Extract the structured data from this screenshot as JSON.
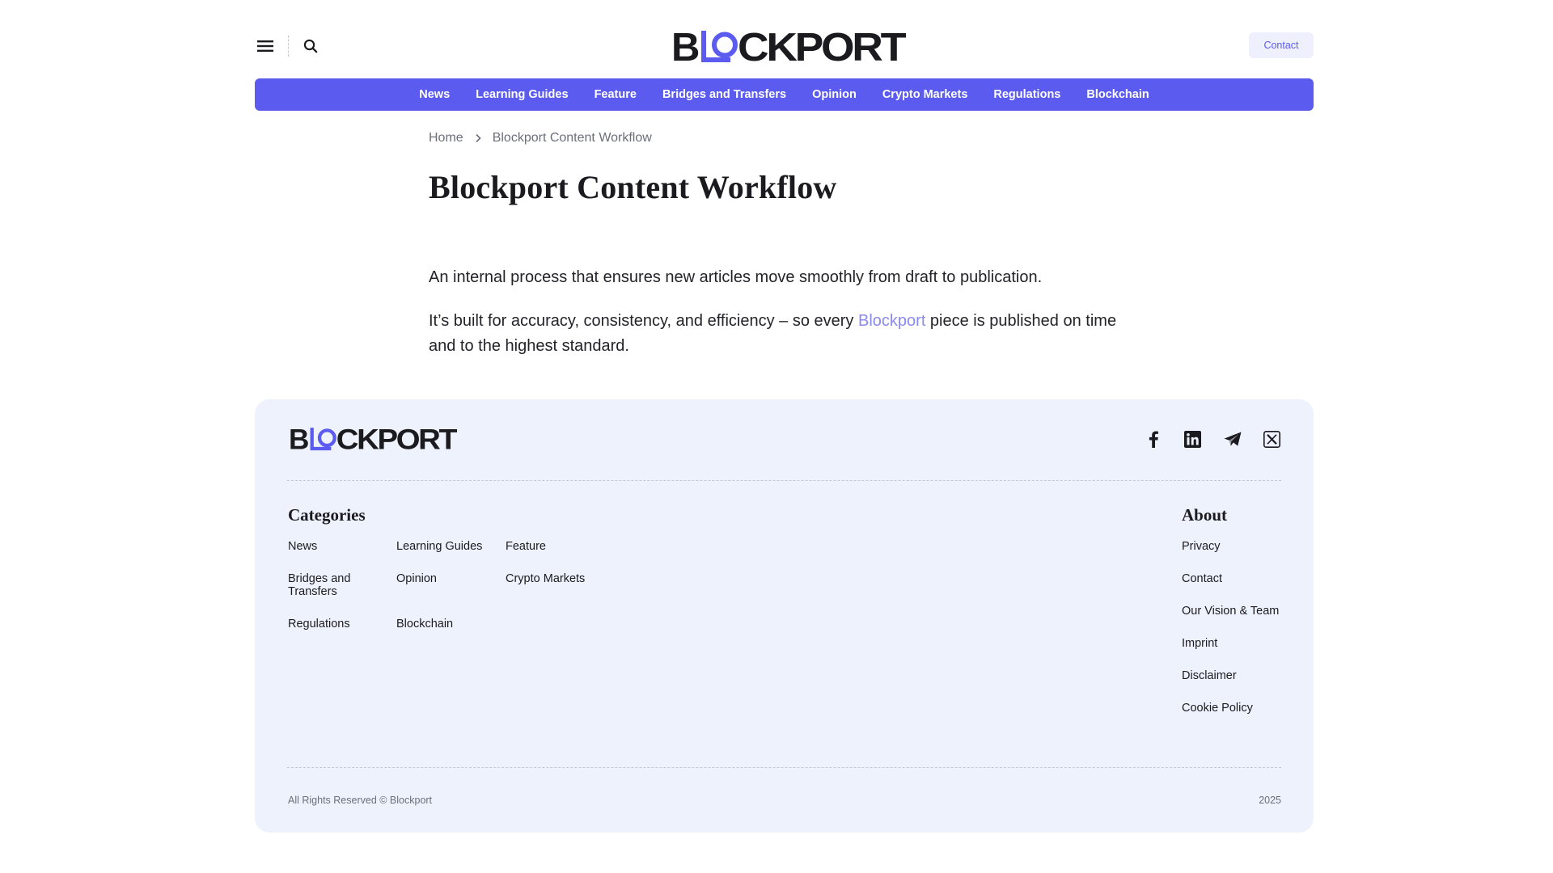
{
  "header": {
    "logo_text": "BLOCKPORT",
    "contact_label": "Contact"
  },
  "nav": {
    "items": [
      "News",
      "Learning Guides",
      "Feature",
      "Bridges and Transfers",
      "Opinion",
      "Crypto Markets",
      "Regulations",
      "Blockchain"
    ]
  },
  "breadcrumb": {
    "home": "Home",
    "current": "Blockport Content Workflow"
  },
  "page": {
    "title": "Blockport Content Workflow",
    "paragraph1": "An internal process that ensures new articles move smoothly from draft to publication.",
    "paragraph2_before": "It’s built for accuracy, consistency, and efficiency – so every ",
    "paragraph2_link": "Blockport",
    "paragraph2_after": " piece is published on time and to the highest standard."
  },
  "footer": {
    "logo_text": "BLOCKPORT",
    "socials": [
      "facebook-icon",
      "linkedin-icon",
      "telegram-icon",
      "x-icon"
    ],
    "categories_heading": "Categories",
    "categories": [
      "News",
      "Learning Guides",
      "Feature",
      "Bridges and Transfers",
      "Opinion",
      "Crypto Markets",
      "Regulations",
      "Blockchain"
    ],
    "about_heading": "About",
    "about_links": [
      "Privacy",
      "Contact",
      "Our Vision & Team",
      "Imprint",
      "Disclaimer",
      "Cookie Policy"
    ],
    "copyright": "All Rights Reserved © Blockport",
    "year": "2025"
  },
  "colors": {
    "accent": "#5b5bf0",
    "footer_bg": "#eef2fd",
    "link": "#8a8af3",
    "text": "#1b1b1f"
  }
}
